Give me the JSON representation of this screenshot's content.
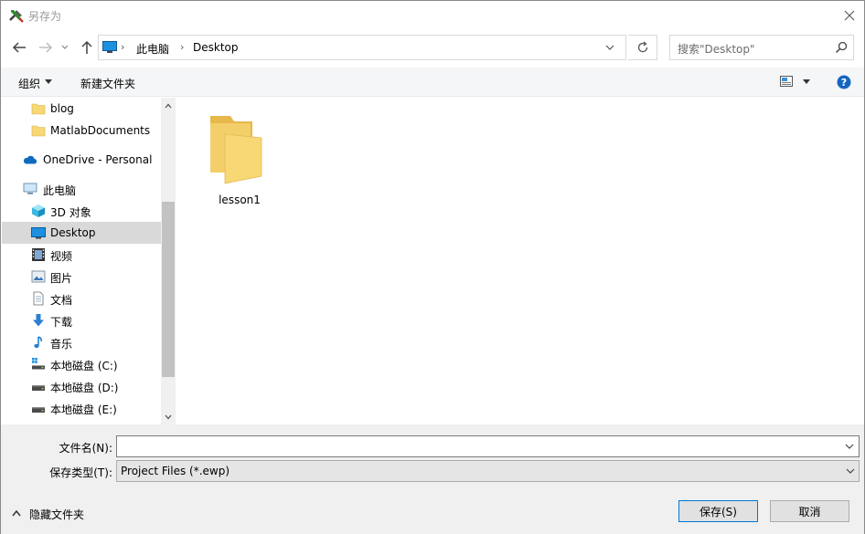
{
  "window": {
    "title": "另存为",
    "title_icon": "tools-icon",
    "close_icon": "close-icon"
  },
  "navigation": {
    "back_icon": "arrow-left-icon",
    "forward_icon": "arrow-right-icon",
    "recent_icon": "chevron-down-icon",
    "up_icon": "arrow-up-icon",
    "breadcrumb": [
      "此电脑",
      "Desktop"
    ],
    "breadcrumb_separator": "›",
    "refresh_icon": "refresh-icon",
    "search_placeholder": "搜索\"Desktop\""
  },
  "commandbar": {
    "organize_label": "组织",
    "new_folder_label": "新建文件夹",
    "view_icon": "view-layout-icon",
    "help_icon": "help-icon"
  },
  "sidebar": {
    "items": [
      {
        "label": "blog",
        "icon": "folder-icon",
        "selected": false
      },
      {
        "label": "MatlabDocuments",
        "icon": "folder-icon",
        "selected": false
      },
      {
        "label": "OneDrive - Personal",
        "icon": "cloud-icon",
        "selected": false
      },
      {
        "label": "此电脑",
        "icon": "computer-icon",
        "selected": false
      },
      {
        "label": "3D 对象",
        "icon": "cube-icon",
        "selected": false
      },
      {
        "label": "Desktop",
        "icon": "desktop-icon",
        "selected": true
      },
      {
        "label": "视频",
        "icon": "video-icon",
        "selected": false
      },
      {
        "label": "图片",
        "icon": "picture-icon",
        "selected": false
      },
      {
        "label": "文档",
        "icon": "document-icon",
        "selected": false
      },
      {
        "label": "下载",
        "icon": "download-icon",
        "selected": false
      },
      {
        "label": "音乐",
        "icon": "music-icon",
        "selected": false
      },
      {
        "label": "本地磁盘 (C:)",
        "icon": "system-drive-icon",
        "selected": false
      },
      {
        "label": "本地磁盘 (D:)",
        "icon": "drive-icon",
        "selected": false
      },
      {
        "label": "本地磁盘 (E:)",
        "icon": "drive-icon",
        "selected": false
      }
    ]
  },
  "content": {
    "items": [
      {
        "label": "lesson1",
        "icon": "folder-icon"
      }
    ]
  },
  "form": {
    "filename_label": "文件名(N):",
    "filename_value": "",
    "filetype_label": "保存类型(T):",
    "filetype_value": "Project Files (*.ewp)"
  },
  "footer": {
    "hide_folders_label": "隐藏文件夹",
    "save_label": "保存(S)",
    "cancel_label": "取消"
  },
  "colors": {
    "selected_bg": "#d9d9d9",
    "folder_yellow": "#f8d775",
    "accent_blue": "#0078d7",
    "bottom_bg": "#f0f0f0"
  }
}
